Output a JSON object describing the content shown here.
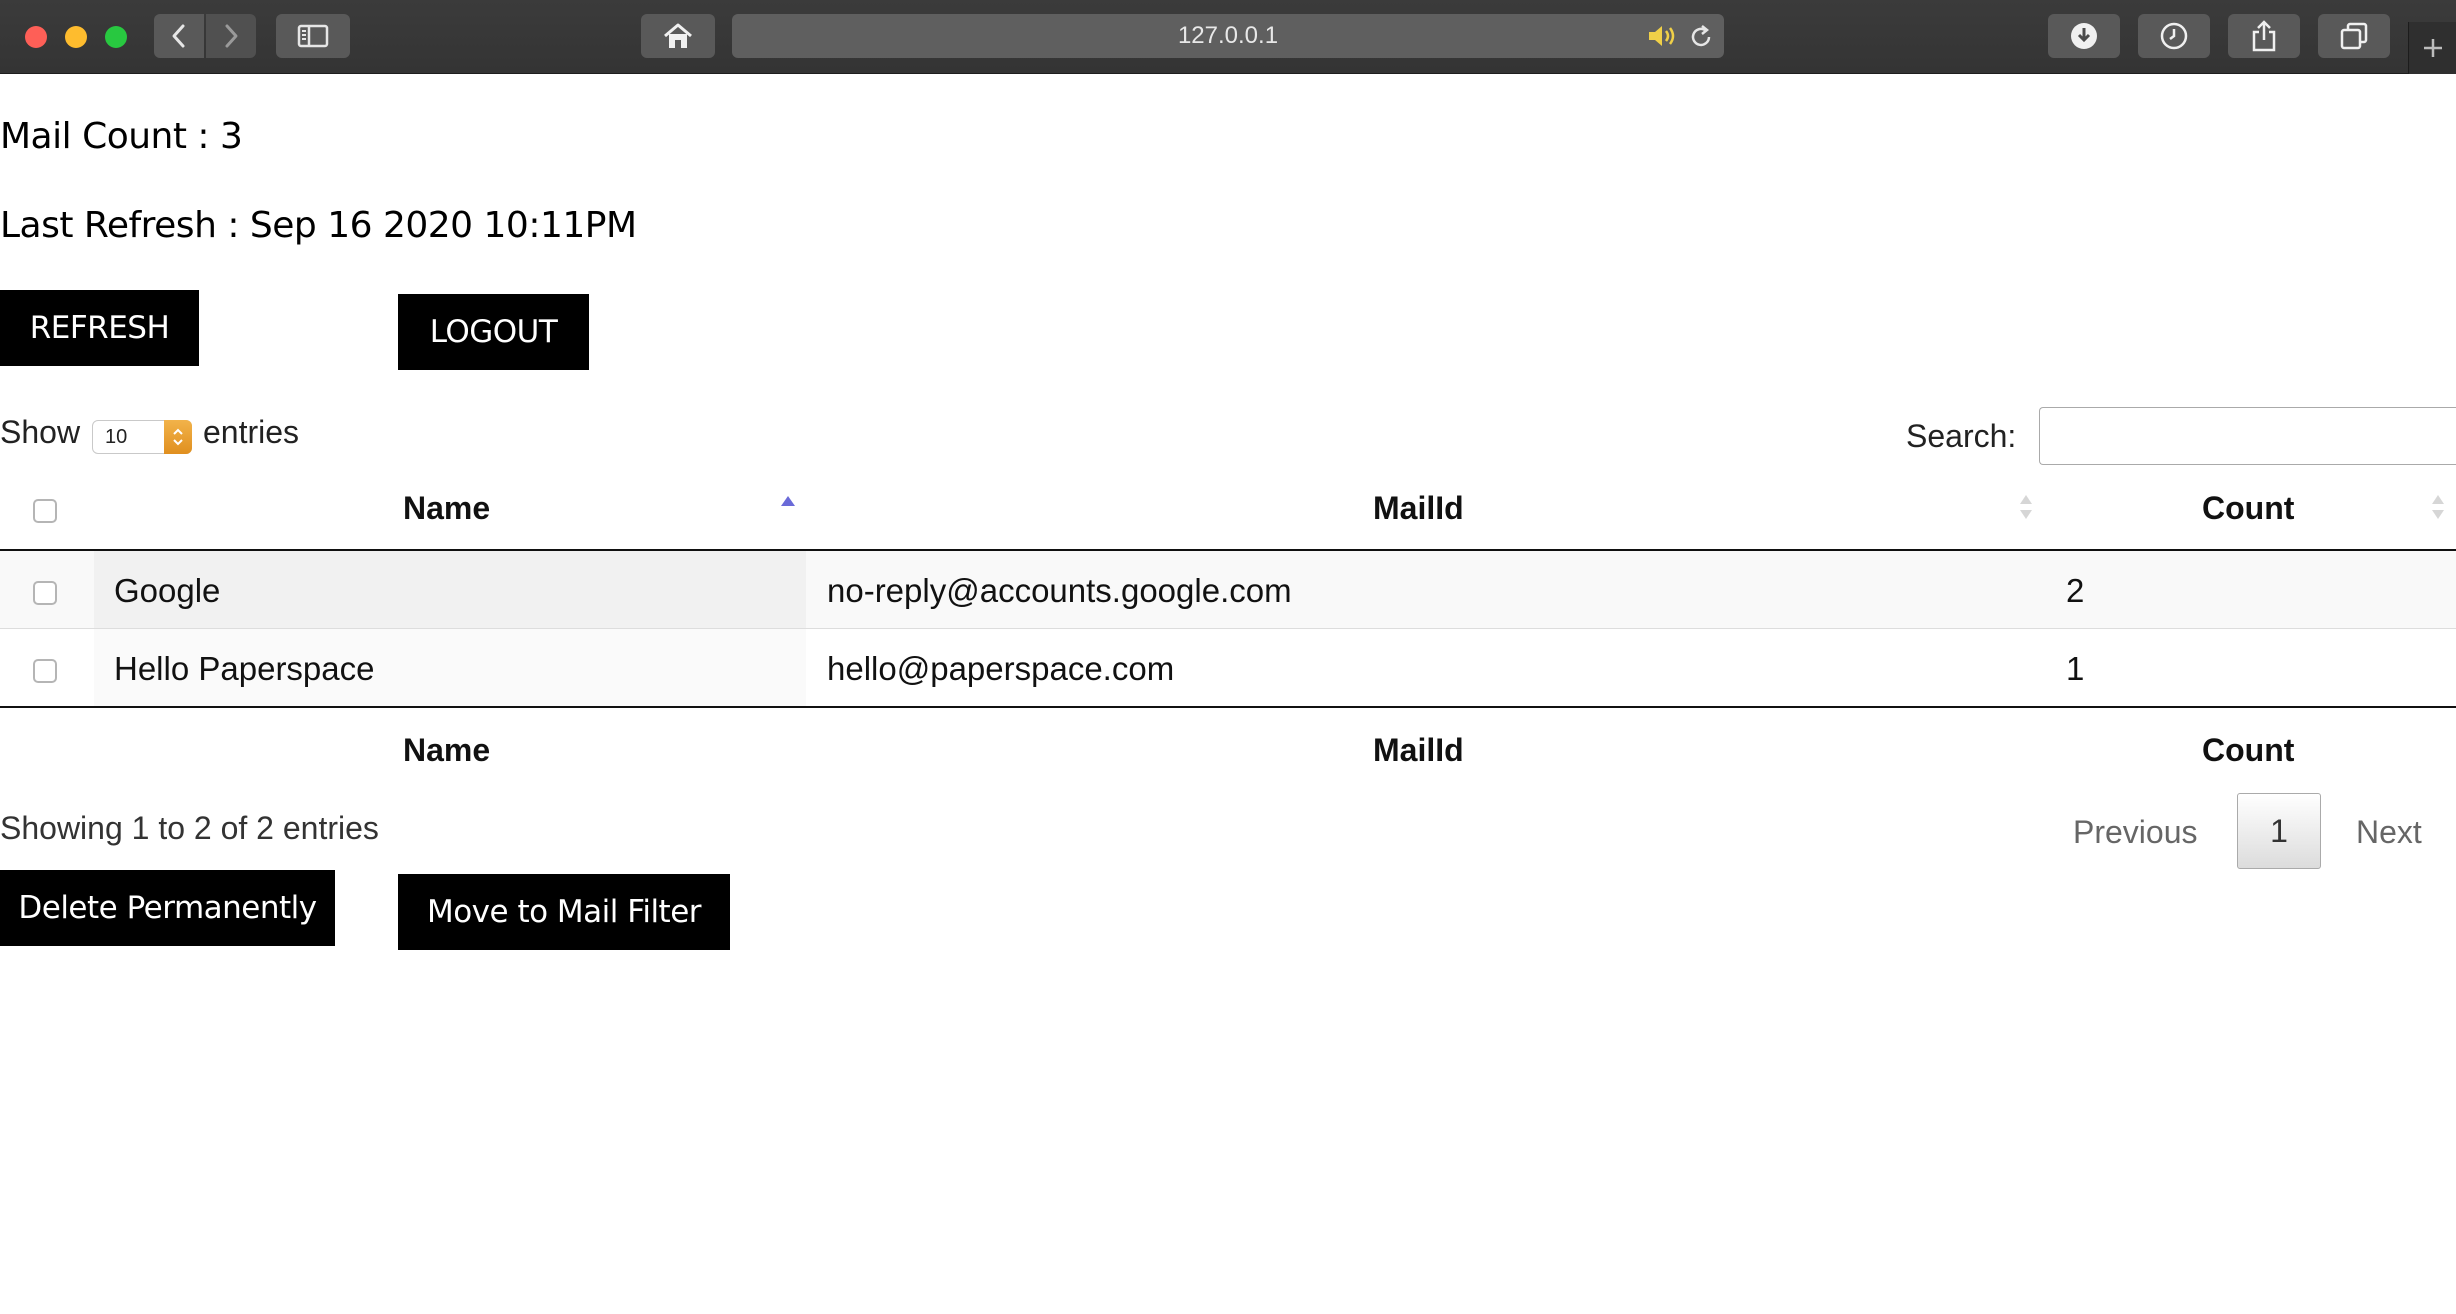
{
  "browser": {
    "url": "127.0.0.1"
  },
  "page": {
    "mail_count": "Mail Count : 3",
    "last_refresh": "Last Refresh : Sep 16 2020 10:11PM",
    "refresh_label": "REFRESH",
    "logout_label": "LOGOUT",
    "show_label": "Show",
    "entries_label": "entries",
    "page_length": "10",
    "search_label": "Search:",
    "search_value": "",
    "delete_label": "Delete Permanently",
    "move_label": "Move to Mail Filter"
  },
  "table": {
    "headers": [
      "Name",
      "MailId",
      "Count"
    ],
    "footers": [
      "Name",
      "MailId",
      "Count"
    ],
    "sorted_column": "Name",
    "rows": [
      {
        "name": "Google",
        "mailid": "no-reply@accounts.google.com",
        "count": "2"
      },
      {
        "name": "Hello Paperspace",
        "mailid": "hello@paperspace.com",
        "count": "1"
      }
    ],
    "info": "Showing 1 to 2 of 2 entries"
  },
  "pagination": {
    "previous": "Previous",
    "current": "1",
    "next": "Next"
  },
  "colors": {
    "button_bg": "#000000",
    "button_text": "#ffffff",
    "sort_active": "#6a6ad8",
    "stepper": "#e8a030"
  }
}
